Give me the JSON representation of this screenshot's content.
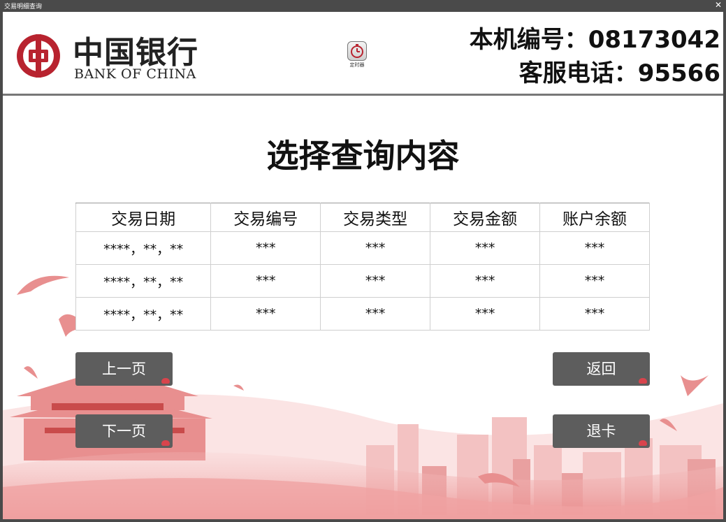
{
  "window": {
    "title": "交易明细查询",
    "close_glyph": "✕"
  },
  "header": {
    "bank_name_cn": "中国银行",
    "bank_name_en": "BANK OF CHINA",
    "timer_label": "定时器",
    "machine_label": "本机编号：",
    "machine_number": "08173042",
    "service_label": "客服电话：",
    "service_number": "95566"
  },
  "main": {
    "title": "选择查询内容",
    "table": {
      "columns": [
        "交易日期",
        "交易编号",
        "交易类型",
        "交易金额",
        "账户余额"
      ],
      "rows": [
        [
          "****，**，**",
          "***",
          "***",
          "***",
          "***"
        ],
        [
          "****，**，**",
          "***",
          "***",
          "***",
          "***"
        ],
        [
          "****，**，**",
          "***",
          "***",
          "***",
          "***"
        ]
      ]
    }
  },
  "buttons": {
    "prev": "上一页",
    "next": "下一页",
    "back": "返回",
    "eject": "退卡"
  },
  "colors": {
    "brand_red": "#b8232f",
    "button_gray": "#5d5d5d",
    "titlebar": "#4a4a4a",
    "art_pink": "#f0a3a3"
  },
  "icons": {
    "logo": "bank-of-china-emblem-icon",
    "timer": "timer-icon",
    "close": "close-icon"
  }
}
